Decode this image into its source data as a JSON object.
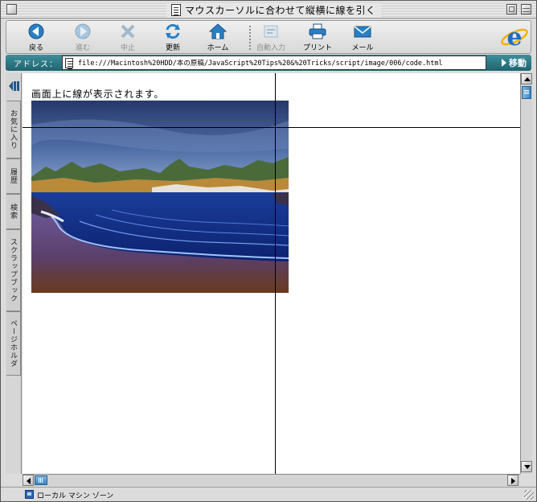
{
  "window": {
    "title": "マウスカーソルに合わせて縦横に線を引く"
  },
  "toolbar": {
    "buttons": [
      {
        "id": "back",
        "label": "戻る",
        "icon": "back-arrow-icon",
        "enabled": true
      },
      {
        "id": "forward",
        "label": "進む",
        "icon": "forward-arrow-icon",
        "enabled": false
      },
      {
        "id": "stop",
        "label": "中止",
        "icon": "stop-x-icon",
        "enabled": false
      },
      {
        "id": "refresh",
        "label": "更新",
        "icon": "refresh-icon",
        "enabled": true
      },
      {
        "id": "home",
        "label": "ホーム",
        "icon": "home-icon",
        "enabled": true
      },
      {
        "id": "autofill",
        "label": "自動入力",
        "icon": "autofill-icon",
        "enabled": false
      },
      {
        "id": "print",
        "label": "プリント",
        "icon": "printer-icon",
        "enabled": true
      },
      {
        "id": "mail",
        "label": "メール",
        "icon": "mail-icon",
        "enabled": true
      }
    ],
    "brand_icon": "internet-explorer-logo"
  },
  "address": {
    "label": "アドレス：",
    "url": "file:///Macintosh%20HDD/本の原稿/JavaScript%20Tips%20&%20Tricks/script/image/006/code.html",
    "go_label": "移動"
  },
  "sidebar": {
    "tabs": [
      "お気に入り",
      "履歴",
      "検索",
      "スクラップブック",
      "ページホルダ"
    ]
  },
  "page": {
    "message": "画面上に線が表示されます。",
    "image_description_icon": "landscape-photo"
  },
  "status": {
    "zone_text": "ローカル マシン ゾーン",
    "zone_icon": "local-machine-zone-icon"
  },
  "colors": {
    "address_bar": "#2a7582",
    "accent_blue": "#2a6fb5",
    "crosshair": "#000000"
  }
}
